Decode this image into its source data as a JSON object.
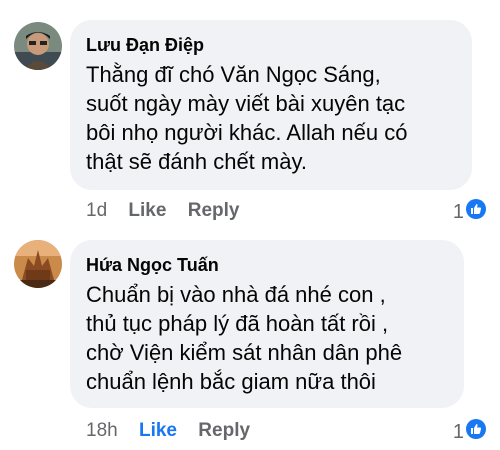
{
  "comments": [
    {
      "author": "Lưu Đạn Điệp",
      "text": "Thằng đĩ chó Văn Ngọc Sáng,\nsuốt ngày mày viết bài xuyên tạc\nbôi nhọ người khác. Allah nếu có\nthật sẽ đánh chết mày.",
      "time": "1d",
      "like_label": "Like",
      "reply_label": "Reply",
      "reaction_count": "1",
      "reaction_icon": "like-reaction-icon",
      "like_active": false
    },
    {
      "author": "Hứa Ngọc Tuấn",
      "text": "Chuẩn bị vào nhà đá nhé con ,\nthủ tục pháp lý đã hoàn tất rồi ,\nchờ Viện kiểm sát nhân dân phê\nchuẩn lệnh bắc giam nữa thôi",
      "time": "18h",
      "like_label": "Like",
      "reply_label": "Reply",
      "reaction_count": "1",
      "reaction_icon": "like-reaction-icon",
      "like_active": true
    }
  ],
  "colors": {
    "bubble": "#f0f2f5",
    "meta": "#65676b",
    "accent": "#1877f2"
  }
}
